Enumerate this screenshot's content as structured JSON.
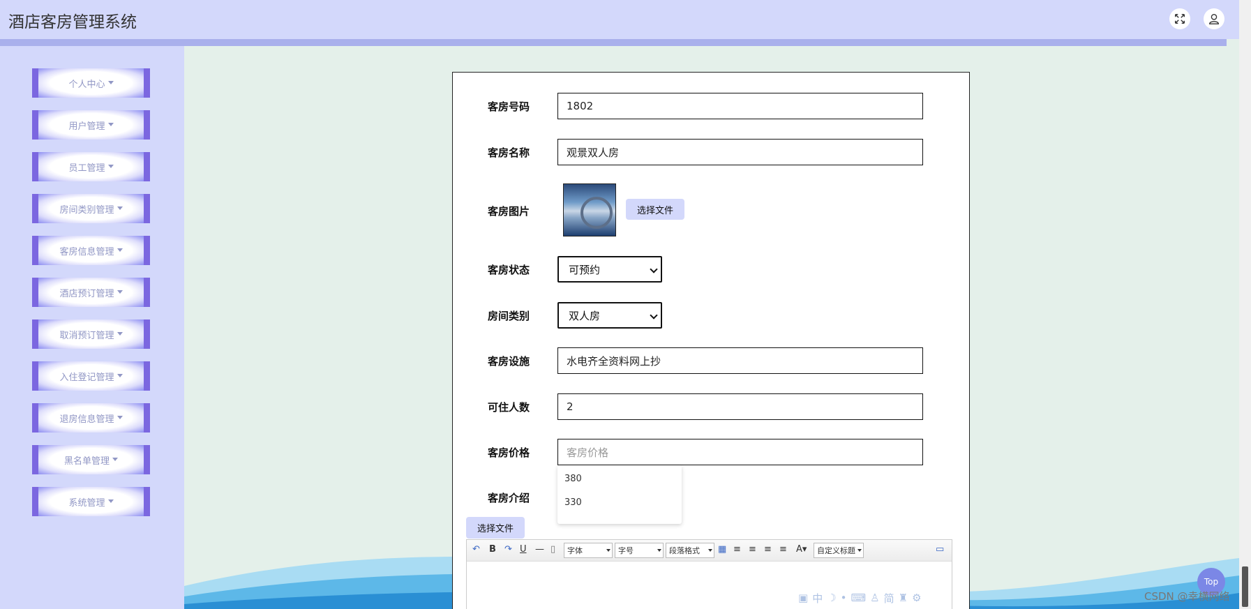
{
  "header": {
    "title": "酒店客房管理系统",
    "fullscreen_icon": "expand-icon",
    "user_icon": "user-icon"
  },
  "sidebar": {
    "items": [
      {
        "label": "个人中心"
      },
      {
        "label": "用户管理"
      },
      {
        "label": "员工管理"
      },
      {
        "label": "房间类别管理"
      },
      {
        "label": "客房信息管理"
      },
      {
        "label": "酒店预订管理"
      },
      {
        "label": "取消预订管理"
      },
      {
        "label": "入住登记管理"
      },
      {
        "label": "退房信息管理"
      },
      {
        "label": "黑名单管理"
      },
      {
        "label": "系统管理"
      }
    ]
  },
  "form": {
    "room_number": {
      "label": "客房号码",
      "value": "1802"
    },
    "room_name": {
      "label": "客房名称",
      "value": "观景双人房"
    },
    "room_image": {
      "label": "客房图片",
      "button": "选择文件"
    },
    "room_status": {
      "label": "客房状态",
      "value": "可预约"
    },
    "room_type": {
      "label": "房间类别",
      "value": "双人房"
    },
    "facilities": {
      "label": "客房设施",
      "value": "水电齐全资料网上抄"
    },
    "capacity": {
      "label": "可住人数",
      "value": "2"
    },
    "price": {
      "label": "客房价格",
      "placeholder": "客房价格",
      "suggestions": [
        "380",
        "330"
      ]
    },
    "intro": {
      "label": "客房介绍",
      "button": "选择文件"
    }
  },
  "editor": {
    "font_select": "字体",
    "size_select": "字号",
    "format_select": "段落格式",
    "custom_title_select": "自定义标题"
  },
  "ime_bar": {
    "zh": "中",
    "simplified": "简"
  },
  "top_button": "Top",
  "watermark": "CSDN @幸横网络"
}
